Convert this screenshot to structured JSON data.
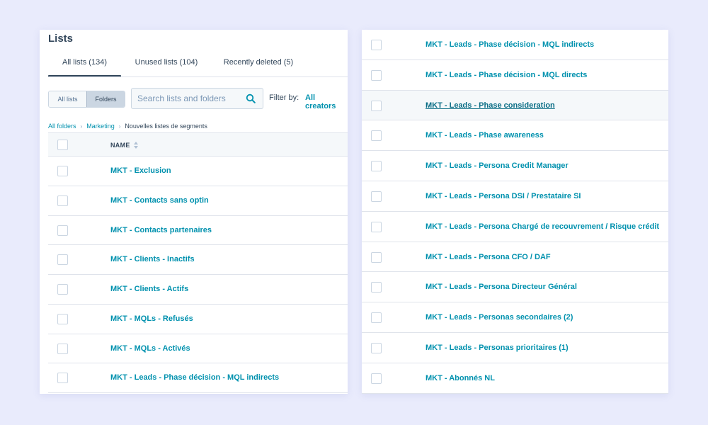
{
  "left": {
    "title": "Lists",
    "tabs": [
      {
        "label": "All lists (134)"
      },
      {
        "label": "Unused lists (104)"
      },
      {
        "label": "Recently deleted (5)"
      }
    ],
    "toggle": {
      "all_lists": "All lists",
      "folders": "Folders"
    },
    "search": {
      "placeholder": "Search lists and folders"
    },
    "filter": {
      "label": "Filter by:",
      "value": "All creators"
    },
    "breadcrumb": {
      "root": "All folders",
      "folder": "Marketing",
      "current": "Nouvelles listes de segments"
    },
    "table": {
      "name_header": "NAME",
      "rows": [
        "MKT - Exclusion",
        "MKT - Contacts sans optin",
        "MKT - Contacts partenaires",
        "MKT - Clients - Inactifs",
        "MKT - Clients - Actifs",
        "MKT - MQLs - Refusés",
        "MKT - MQLs - Activés",
        "MKT - Leads - Phase décision - MQL indirects"
      ]
    }
  },
  "right": {
    "rows": [
      "MKT - Leads - Phase décision - MQL indirects",
      "MKT - Leads - Phase décision - MQL directs",
      "MKT - Leads - Phase consideration",
      "MKT - Leads - Phase awareness",
      "MKT - Leads - Persona Credit Manager",
      "MKT - Leads - Persona DSI / Prestataire SI",
      "MKT - Leads - Persona Chargé de recouvrement / Risque crédit",
      "MKT - Leads - Persona CFO / DAF",
      "MKT - Leads - Persona Directeur Général",
      "MKT - Leads - Personas secondaires (2)",
      "MKT - Leads - Personas prioritaires (1)",
      "MKT - Abonnés NL"
    ]
  },
  "colors": {
    "background": "#e9ebfc",
    "link": "#0091ae",
    "text": "#33475b",
    "border": "#dfe3eb"
  },
  "icons": {
    "search": "search-icon",
    "breadcrumb_separator": "chevron-right-icon",
    "sort": "sort-icon"
  }
}
